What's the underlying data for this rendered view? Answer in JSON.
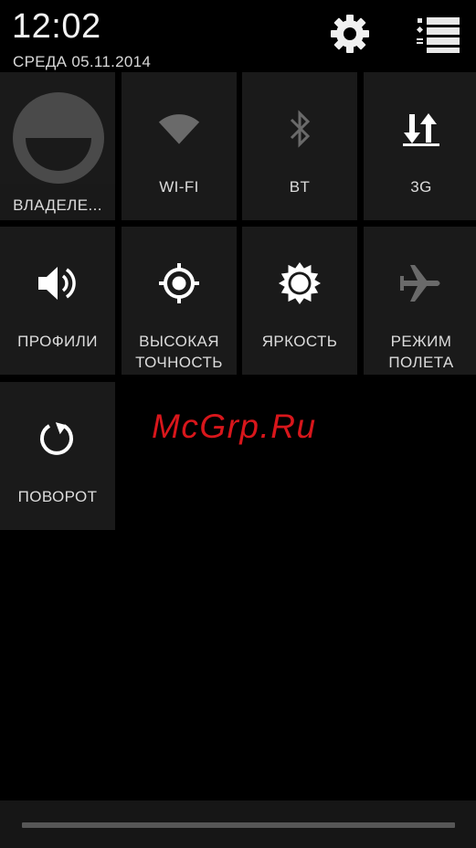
{
  "status": {
    "time": "12:02",
    "date": "СРЕДА 05.11.2014"
  },
  "header": {
    "settings_icon": "gear-icon",
    "list_icon": "list-settings-icon"
  },
  "tiles": [
    {
      "label": "ВЛАДЕЛЕ...",
      "icon": "user-avatar"
    },
    {
      "label": "WI-FI",
      "icon": "wifi-icon",
      "state": "off"
    },
    {
      "label": "BT",
      "icon": "bluetooth-icon",
      "state": "off"
    },
    {
      "label": "3G",
      "icon": "mobile-data-icon",
      "state": "on"
    },
    {
      "label": "ПРОФИЛИ",
      "icon": "volume-icon"
    },
    {
      "label": "ВЫСОКАЯ\nТОЧНОСТЬ",
      "icon": "location-icon"
    },
    {
      "label": "ЯРКОСТЬ",
      "icon": "brightness-icon"
    },
    {
      "label": "РЕЖИМ\nПОЛЕТА",
      "icon": "airplane-icon",
      "state": "off"
    },
    {
      "label": "ПОВОРОТ",
      "icon": "rotate-icon"
    }
  ],
  "watermark": "McGrp.Ru",
  "colors": {
    "background": "#000000",
    "tile": "#1a1a1a",
    "watermark": "#d8161b"
  }
}
